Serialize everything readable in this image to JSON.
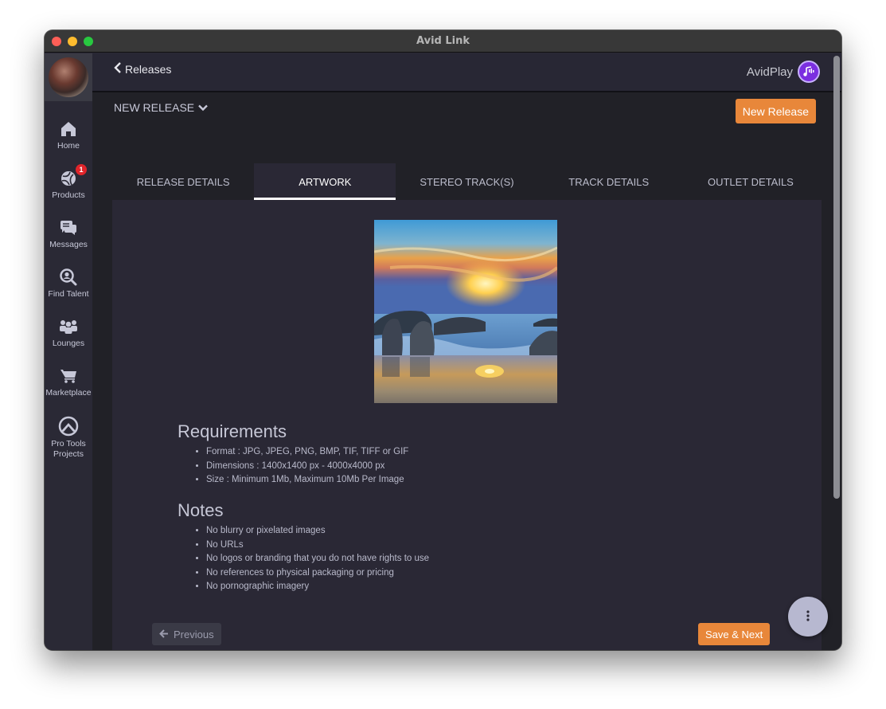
{
  "window": {
    "title": "Avid Link"
  },
  "sidebar": {
    "avatar_alt": "User avatar",
    "items": [
      {
        "label": "Home",
        "icon": "home-icon"
      },
      {
        "label": "Products",
        "icon": "products-icon",
        "badge": "1"
      },
      {
        "label": "Messages",
        "icon": "messages-icon"
      },
      {
        "label": "Find Talent",
        "icon": "find-talent-icon"
      },
      {
        "label": "Lounges",
        "icon": "lounges-icon"
      },
      {
        "label": "Marketplace",
        "icon": "cart-icon"
      },
      {
        "label": "Pro Tools Projects",
        "icon": "pro-tools-icon"
      }
    ]
  },
  "header": {
    "back_label": "Releases",
    "brand_label": "AvidPlay"
  },
  "toolbar": {
    "release_select": "NEW RELEASE",
    "new_release_label": "New Release"
  },
  "tabs": [
    {
      "label": "RELEASE DETAILS",
      "active": false
    },
    {
      "label": "ARTWORK",
      "active": true
    },
    {
      "label": "STEREO TRACK(S)",
      "active": false
    },
    {
      "label": "TRACK DETAILS",
      "active": false
    },
    {
      "label": "OUTLET DETAILS",
      "active": false
    }
  ],
  "artwork": {
    "description": "Sunset over beach with rocks"
  },
  "requirements": {
    "title": "Requirements",
    "items": [
      "Format : JPG, JPEG, PNG, BMP, TIF, TIFF or GIF",
      "Dimensions : 1400x1400 px - 4000x4000 px",
      "Size : Minimum 1Mb, Maximum 10Mb Per Image"
    ]
  },
  "notes": {
    "title": "Notes",
    "items": [
      "No blurry or pixelated images",
      "No URLs",
      "No logos or branding that you do not have rights to use",
      "No references to physical packaging or pricing",
      "No pornographic imagery"
    ]
  },
  "footer": {
    "previous_label": "Previous",
    "save_next_label": "Save & Next"
  },
  "colors": {
    "accent": "#e8873a",
    "brand": "#7b2fe0",
    "badge": "#e0242a"
  }
}
